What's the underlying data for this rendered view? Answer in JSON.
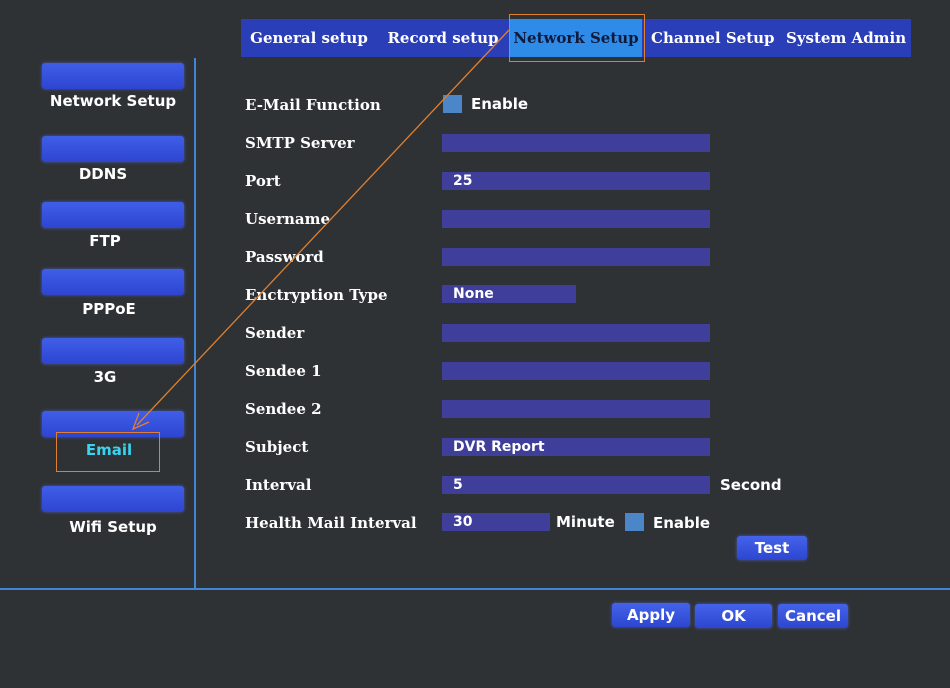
{
  "header": {
    "tabs": [
      {
        "label": "General setup"
      },
      {
        "label": "Record setup"
      },
      {
        "label": "Network Setup",
        "active": true
      },
      {
        "label": "Channel Setup"
      },
      {
        "label": "System Admin"
      }
    ]
  },
  "sidebar": {
    "items": [
      {
        "label": "Network  Setup"
      },
      {
        "label": "DDNS"
      },
      {
        "label": "FTP"
      },
      {
        "label": "PPPoE"
      },
      {
        "label": "3G"
      },
      {
        "label": "Email",
        "active": true
      },
      {
        "label": "Wifi Setup"
      }
    ]
  },
  "form": {
    "email_function": {
      "label": "E-Mail Function",
      "checkbox_label": "Enable"
    },
    "smtp_server": {
      "label": "SMTP Server",
      "value": ""
    },
    "port": {
      "label": "Port",
      "value": "25"
    },
    "username": {
      "label": "Username",
      "value": ""
    },
    "password": {
      "label": "Password",
      "value": ""
    },
    "encryption_type": {
      "label": "Enctryption Type",
      "value": "None"
    },
    "sender": {
      "label": "Sender",
      "value": ""
    },
    "sendee1": {
      "label": "Sendee 1",
      "value": ""
    },
    "sendee2": {
      "label": "Sendee 2",
      "value": ""
    },
    "subject": {
      "label": "Subject",
      "value": "DVR Report"
    },
    "interval": {
      "label": "Interval",
      "value": "5",
      "unit": "Second"
    },
    "health_mail_interval": {
      "label": "Health Mail Interval",
      "value": "30",
      "unit": "Minute",
      "checkbox_label": "Enable"
    },
    "test_label": "Test"
  },
  "footer": {
    "apply_label": "Apply",
    "ok_label": "OK",
    "cancel_label": "Cancel"
  },
  "colors": {
    "background": "#2f3235",
    "tab_bar": "#2a3eb8",
    "tab_active": "#2f8be8",
    "input": "#3f3e9a",
    "button": "#3a55e0",
    "active_sidebar_text": "#39d4f0",
    "divider": "#3f86d6",
    "annotation": "#e0802f"
  }
}
